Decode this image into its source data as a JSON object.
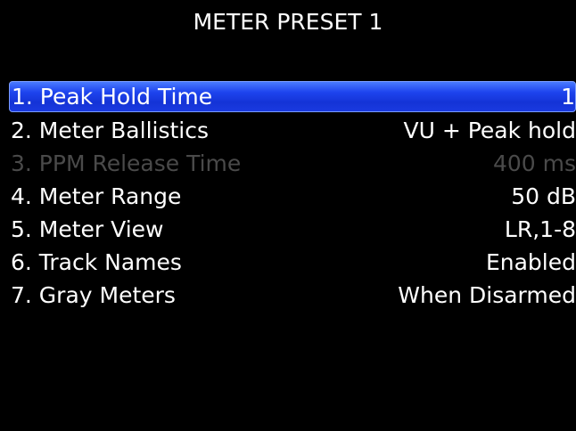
{
  "header": {
    "title": "METER PRESET 1"
  },
  "menu": {
    "items": [
      {
        "label": "1. Peak Hold Time",
        "value": "1",
        "selected": true,
        "enabled": true
      },
      {
        "label": "2. Meter Ballistics",
        "value": "VU + Peak hold",
        "selected": false,
        "enabled": true
      },
      {
        "label": "3. PPM Release Time",
        "value": "400 ms",
        "selected": false,
        "enabled": false
      },
      {
        "label": "4. Meter Range",
        "value": "50 dB",
        "selected": false,
        "enabled": true
      },
      {
        "label": "5. Meter View",
        "value": "LR,1-8",
        "selected": false,
        "enabled": true
      },
      {
        "label": "6. Track Names",
        "value": "Enabled",
        "selected": false,
        "enabled": true
      },
      {
        "label": "7. Gray Meters",
        "value": "When Disarmed",
        "selected": false,
        "enabled": true
      }
    ]
  },
  "colors": {
    "background": "#000000",
    "text": "#ffffff",
    "selection": "#1e44ee",
    "disabled_text": "#4a4a4a"
  }
}
